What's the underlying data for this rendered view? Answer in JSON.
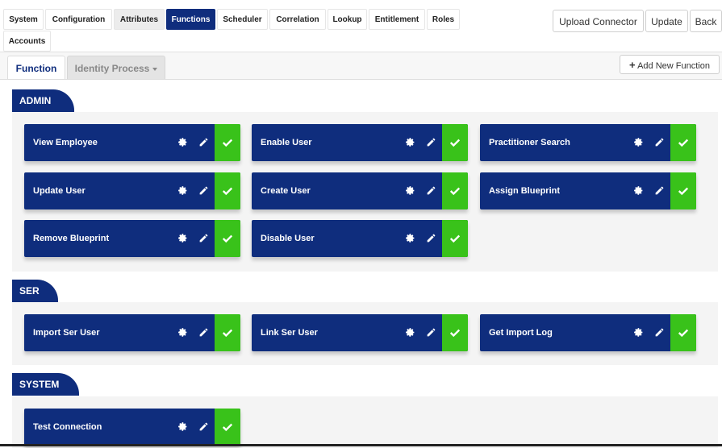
{
  "top_tabs": [
    "System",
    "Configuration",
    "Attributes",
    "Functions",
    "Scheduler",
    "Correlation",
    "Lookup",
    "Entitlement",
    "Roles",
    "Accounts"
  ],
  "active_top_tab": "Functions",
  "actions": {
    "upload": "Upload Connector",
    "update": "Update",
    "back": "Back"
  },
  "sub_tabs": {
    "function": "Function",
    "identity_process": "Identity Process"
  },
  "add_new_function": "Add New Function",
  "colors": {
    "navy": "#0f2d7d",
    "green": "#39c21a"
  },
  "groups": [
    {
      "name": "ADMIN",
      "functions": [
        "View Employee",
        "Enable User",
        "Practitioner Search",
        "Update User",
        "Create User",
        "Assign Blueprint",
        "Remove Blueprint",
        "Disable User"
      ]
    },
    {
      "name": "SER",
      "functions": [
        "Import Ser User",
        "Link Ser User",
        "Get Import Log"
      ]
    },
    {
      "name": "SYSTEM",
      "functions": [
        "Test Connection"
      ]
    }
  ],
  "icons": {
    "settings": "gear-icon",
    "edit": "pencil-icon",
    "enabled": "check-icon",
    "add": "plus-icon"
  }
}
